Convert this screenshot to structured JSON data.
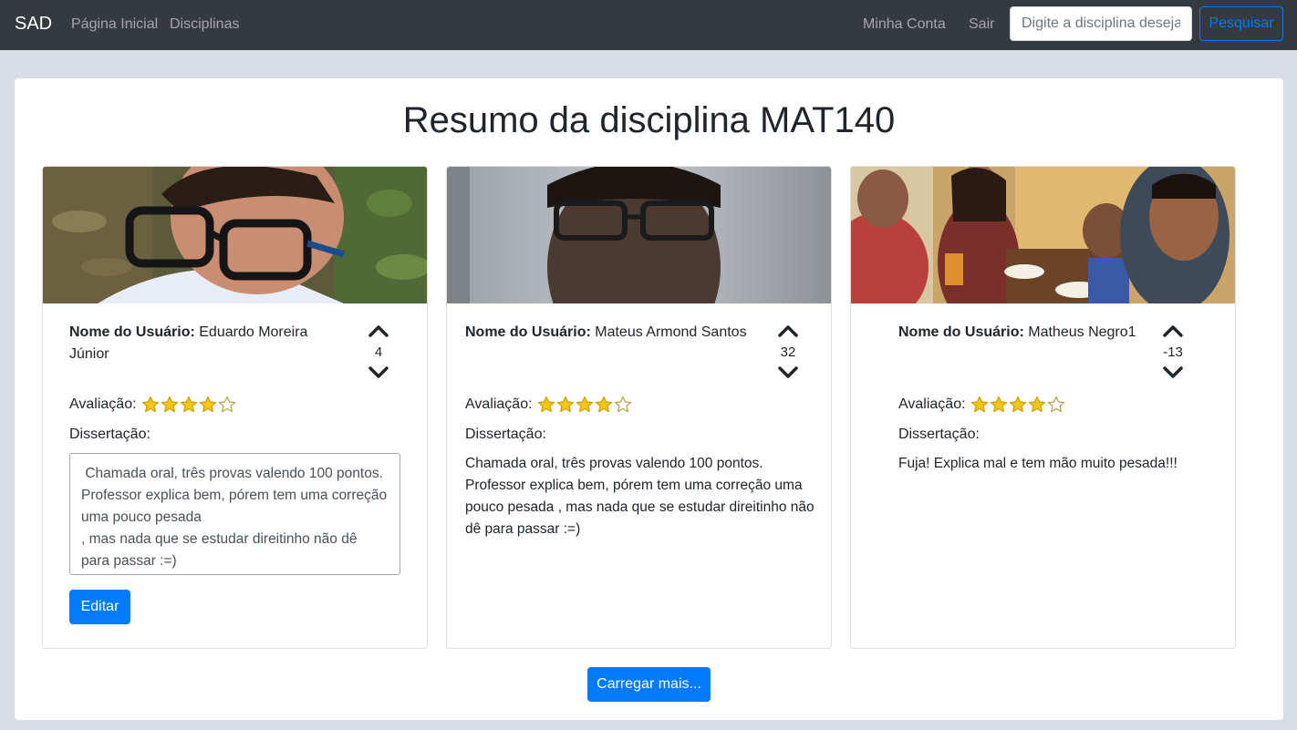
{
  "navbar": {
    "brand": "SAD",
    "links": [
      "Página Inicial",
      "Disciplinas"
    ],
    "account": "Minha Conta",
    "logout": "Sair",
    "search_placeholder": "Digite a disciplina desejada",
    "search_button": "Pesquisar"
  },
  "page": {
    "title": "Resumo da disciplina MAT140",
    "user_label": "Nome do Usuário:",
    "rating_label": "Avaliação:",
    "dissertation_label": "Dissertação:",
    "load_more": "Carregar mais..."
  },
  "reviews": [
    {
      "user_name": "Eduardo Moreira Júnior",
      "votes": "4",
      "rating": 4,
      "rating_max": 5,
      "dissertation": " Chamada oral, três provas valendo 100 pontos.\nProfessor explica bem, pórem tem uma correção uma pouco pesada\n, mas nada que se estudar direitinho não dê para passar :=)",
      "editable": true,
      "edit_button": "Editar"
    },
    {
      "user_name": "Mateus Armond Santos",
      "votes": "32",
      "rating": 4,
      "rating_max": 5,
      "dissertation": "Chamada oral, três provas valendo 100 pontos. Professor explica bem, pórem tem uma correção uma pouco pesada , mas nada que se estudar direitinho não dê para passar :=)",
      "editable": false
    },
    {
      "user_name": "Matheus Negro1",
      "votes": "-13",
      "rating": 4,
      "rating_max": 5,
      "dissertation": "Fuja! Explica mal e tem mão muito pesada!!!",
      "editable": false
    }
  ],
  "colors": {
    "navbar_bg": "#343a40",
    "page_bg": "#d7dce5",
    "primary": "#007bff",
    "star": "#f5c518"
  }
}
